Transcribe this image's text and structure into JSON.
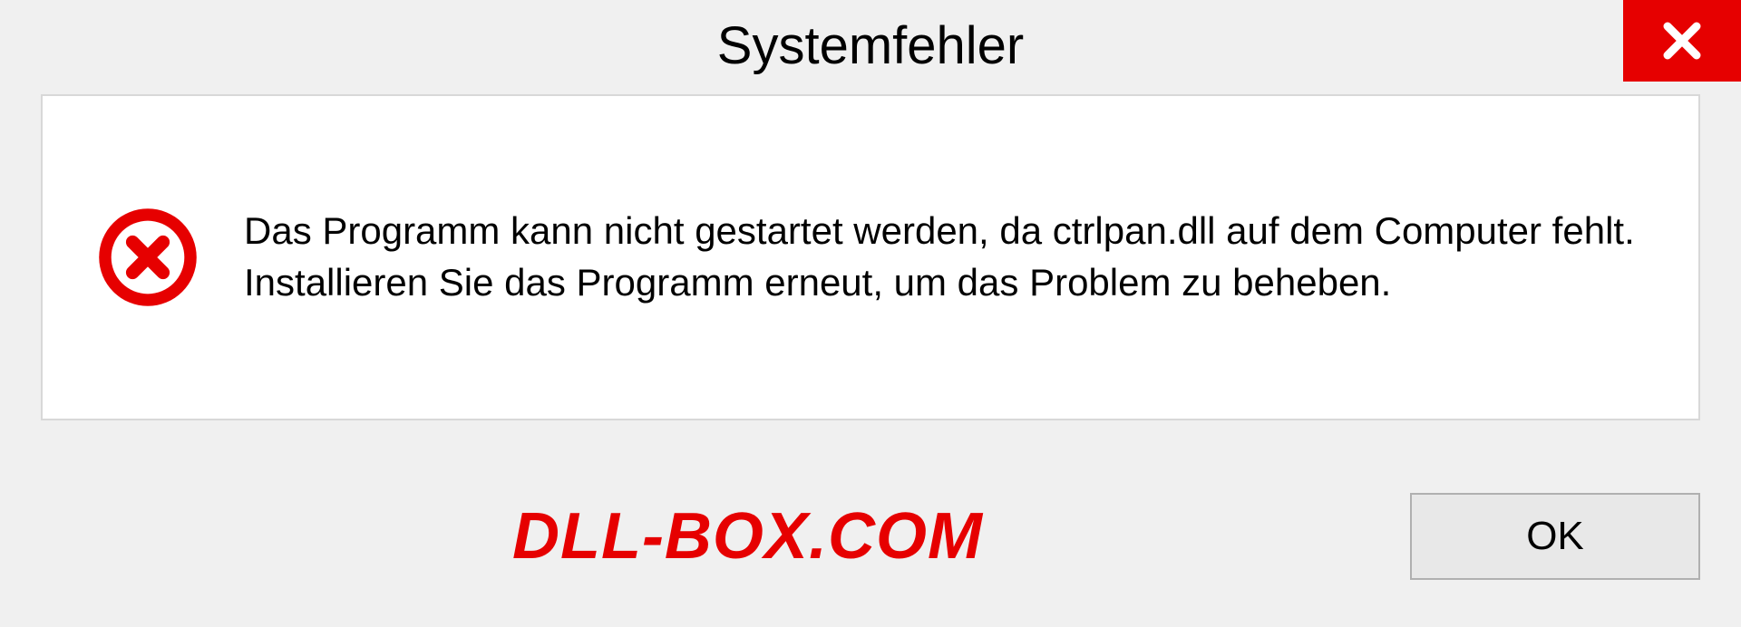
{
  "dialog": {
    "title": "Systemfehler",
    "message": "Das Programm kann nicht gestartet werden, da ctrlpan.dll auf dem Computer fehlt. Installieren Sie das Programm erneut, um das Problem zu beheben.",
    "ok_label": "OK"
  },
  "watermark": "DLL-BOX.COM"
}
